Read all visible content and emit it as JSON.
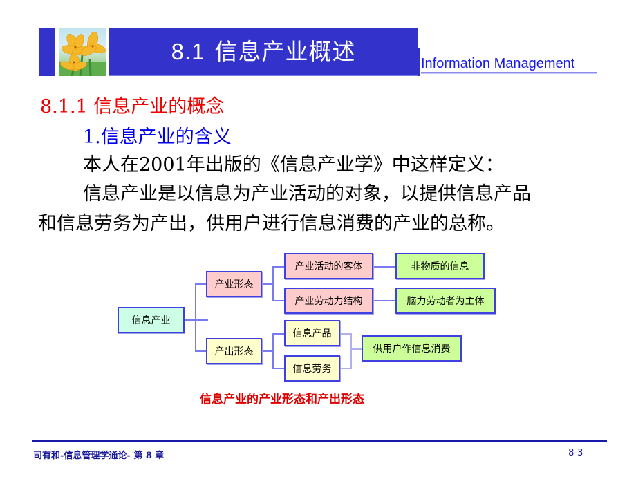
{
  "header": {
    "title_number": "8.1",
    "title_text": "信息产业概述",
    "subtitle_en": "Information Management",
    "decoration_image": "lily-flowers-photo"
  },
  "content": {
    "section_heading": "8.1.1  信息产业的概念",
    "sub_heading": "1.信息产业的含义",
    "paragraph_lines": [
      "本人在2001年出版的《信息产业学》中这样定义：",
      "信息产业是以信息为产业活动的对象，以提供信息产品",
      "和信息劳务为产出，供用户进行信息消费的产业的总称。"
    ]
  },
  "diagram": {
    "root": "信息产业",
    "branches": [
      {
        "label": "产业形态",
        "children": [
          {
            "label": "产业活动的客体",
            "result": "非物质的信息"
          },
          {
            "label": "产业劳动力结构",
            "result": "脑力劳动者为主体"
          }
        ]
      },
      {
        "label": "产出形态",
        "children": [
          {
            "label": "信息产品"
          },
          {
            "label": "信息劳务"
          }
        ],
        "merged_result": "供用户作信息消费"
      }
    ],
    "caption": "信息产业的产业形态和产出形态",
    "colors": {
      "border": "#4040e0",
      "root_fill": "#ccffe6",
      "industry_fill": "#ffcccc",
      "output_fill": "#ffffcc",
      "result_fill": "#ccff99",
      "connector": "#7a7af0"
    }
  },
  "footer": {
    "left": "司有和-信息管理学通论- 第 8 章",
    "right": "— 8-3 —"
  },
  "colors": {
    "title_bar": "#3333cc",
    "section_heading": "#ee0000",
    "sub_heading": "#0000ee",
    "caption": "#dd0000",
    "footer": "#1a1a99"
  }
}
